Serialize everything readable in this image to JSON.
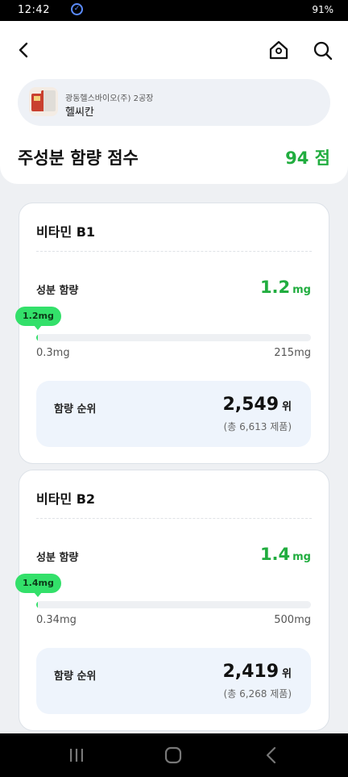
{
  "status_bar": {
    "time": "12:42",
    "right_text": "91%"
  },
  "header": {
    "back_icon": "chevron-left-icon",
    "home_icon": "home-icon",
    "search_icon": "search-icon"
  },
  "product": {
    "manufacturer": "광동헬스바이오(주) 2공장",
    "name": "헬씨칸"
  },
  "score": {
    "title": "주성분 함량 점수",
    "value": "94 점"
  },
  "colors": {
    "accent_green": "#21ad3f",
    "bar_green": "#33e06a",
    "rank_bg": "#eef4fc"
  },
  "ingredients": [
    {
      "name": "비타민 B1",
      "amount_label": "성분 함량",
      "amount_value": "1.2",
      "amount_unit": "mg",
      "bubble": "1.2mg",
      "range_min": "0.3mg",
      "range_max": "215mg",
      "level_fraction": 0.004,
      "rank_label": "함량 순위",
      "rank_value": "2,549",
      "rank_unit": "위",
      "rank_total": "(총 6,613 제품)"
    },
    {
      "name": "비타민 B2",
      "amount_label": "성분 함량",
      "amount_value": "1.4",
      "amount_unit": "mg",
      "bubble": "1.4mg",
      "range_min": "0.34mg",
      "range_max": "500mg",
      "level_fraction": 0.002,
      "rank_label": "함량 순위",
      "rank_value": "2,419",
      "rank_unit": "위",
      "rank_total": "(총 6,268 제품)"
    }
  ]
}
